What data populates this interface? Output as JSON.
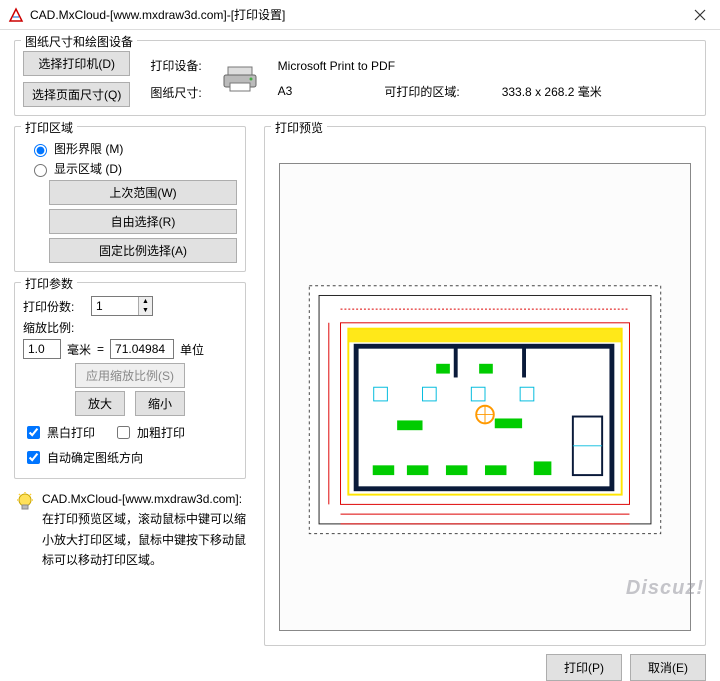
{
  "window": {
    "title": "CAD.MxCloud-[www.mxdraw3d.com]-[打印设置]"
  },
  "paperGroup": {
    "legend": "图纸尺寸和绘图设备",
    "selectPrinterBtn": "选择打印机(D)",
    "selectPageSizeBtn": "选择页面尺寸(Q)",
    "deviceLabel": "打印设备:",
    "deviceValue": "Microsoft Print to PDF",
    "sizeLabel": "图纸尺寸:",
    "sizeValue": "A3",
    "printableLabel": "可打印的区域:",
    "printableValue": "333.8 x 268.2 毫米"
  },
  "areaGroup": {
    "legend": "打印区域",
    "radio1": "图形界限 (M)",
    "radio2": "显示区域 (D)",
    "lastRangeBtn": "上次范围(W)",
    "freeSelectBtn": "自由选择(R)",
    "fixedScaleBtn": "固定比例选择(A)",
    "selected": "limits"
  },
  "paramsGroup": {
    "legend": "打印参数",
    "copiesLabel": "打印份数:",
    "copiesValue": "1",
    "scaleLabel": "缩放比例:",
    "mmValue": "1.0",
    "mmUnit": "毫米",
    "eq": "=",
    "unitsValue": "71.04984",
    "unitsLabel": "单位",
    "applyScaleBtn": "应用缩放比例(S)",
    "zoomInBtn": "放大",
    "zoomOutBtn": "缩小",
    "bwPrint": "黑白打印",
    "boldPrint": "加粗打印",
    "autoOrient": "自动确定图纸方向",
    "bwChecked": true,
    "boldChecked": false,
    "autoChecked": true
  },
  "tip": {
    "text": "CAD.MxCloud-[www.mxdraw3d.com]: 在打印预览区域，滚动鼠标中键可以缩小放大打印区域，鼠标中键按下移动鼠标可以移动打印区域。"
  },
  "preview": {
    "legend": "打印预览"
  },
  "footer": {
    "print": "打印(P)",
    "cancel": "取消(E)"
  },
  "watermark": "Discuz!"
}
